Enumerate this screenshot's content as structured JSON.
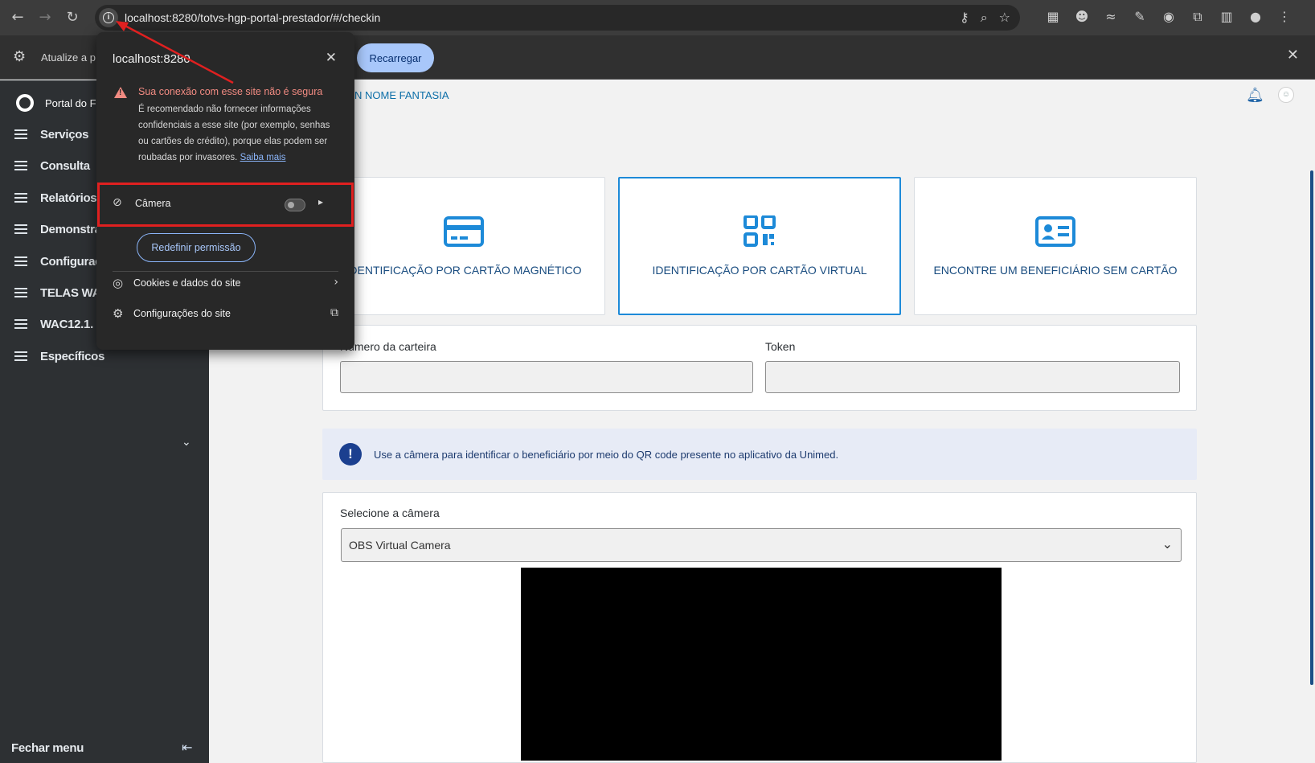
{
  "browser": {
    "url": "localhost:8280/totvs-hgp-portal-prestador/#/checkin",
    "infobar_message": "Atualize a p",
    "reload_label": "Recarregar"
  },
  "sidebar": {
    "brand": "Portal do F",
    "items": [
      {
        "label": "Serviços"
      },
      {
        "label": "Consulta"
      },
      {
        "label": "Relatórios"
      },
      {
        "label": "Demonstra"
      },
      {
        "label": "Configuraç"
      },
      {
        "label": "TELAS WA"
      },
      {
        "label": "WAC12.1."
      },
      {
        "label": "Específicos"
      }
    ],
    "close_label": "Fechar menu"
  },
  "header": {
    "company": "N NOME FANTASIA"
  },
  "options": [
    {
      "label": "IDENTIFICAÇÃO POR CARTÃO MAGNÉTICO",
      "icon": "credit-card-icon",
      "selected": false
    },
    {
      "label": "IDENTIFICAÇÃO POR CARTÃO VIRTUAL",
      "icon": "qr-code-icon",
      "selected": true
    },
    {
      "label": "ENCONTRE UM BENEFICIÁRIO SEM CARTÃO",
      "icon": "id-card-icon",
      "selected": false
    }
  ],
  "form": {
    "card_number_label": "Número da carteira",
    "card_number_value": "",
    "token_label": "Token",
    "token_value": ""
  },
  "alert": {
    "text": "Use a câmera para identificar o beneficiário por meio do QR code presente no aplicativo da Unimed."
  },
  "camera": {
    "select_label": "Selecione a câmera",
    "selected": "OBS Virtual Camera"
  },
  "popup": {
    "host": "localhost:8280",
    "warning_title": "Sua conexão com esse site não é segura",
    "warning_body": "É recomendado não fornecer informações confidenciais a esse site (por exemplo, senhas ou cartões de crédito), porque elas podem ser roubadas por invasores.",
    "learn_more": "Saiba mais",
    "camera_label": "Câmera",
    "camera_enabled": false,
    "reset_label": "Redefinir permissão",
    "cookies_label": "Cookies e dados do site",
    "settings_label": "Configurações do site"
  },
  "colors": {
    "accent": "#1d8ad8",
    "brand_text": "#1a4d80",
    "warning": "#f28b82",
    "annotation": "#e02020"
  }
}
